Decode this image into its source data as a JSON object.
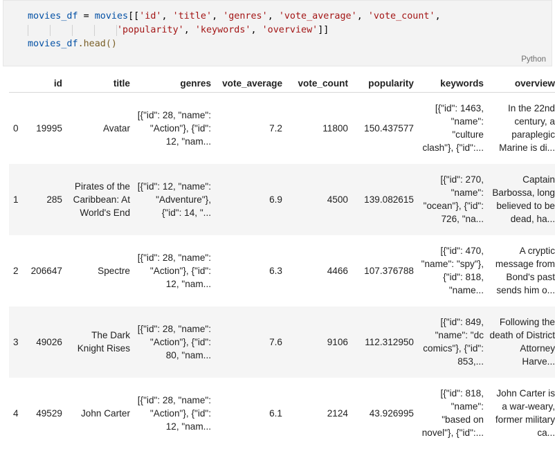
{
  "cell": {
    "code_line1": {
      "var": "movies_df",
      "eq": " = ",
      "src": "movies",
      "open": "[[",
      "cols": [
        "'id'",
        "'title'",
        "'genres'",
        "'vote_average'",
        "'vote_count'"
      ]
    },
    "code_line2": {
      "cols": [
        "'popularity'",
        "'keywords'",
        "'overview'"
      ],
      "close": "]]"
    },
    "code_line3": {
      "var": "movies_df",
      "method": ".head()"
    },
    "language": "Python"
  },
  "table": {
    "columns": [
      "",
      "id",
      "title",
      "genres",
      "vote_average",
      "vote_count",
      "popularity",
      "keywords",
      "overview"
    ],
    "rows": [
      {
        "index": "0",
        "id": "19995",
        "title": "Avatar",
        "genres": "[{\"id\": 28, \"name\": \"Action\"}, {\"id\": 12, \"nam...",
        "vote_average": "7.2",
        "vote_count": "11800",
        "popularity": "150.437577",
        "keywords": "[{\"id\": 1463, \"name\": \"culture clash\"}, {\"id\":...",
        "overview": "In the 22nd century, a paraplegic Marine is di..."
      },
      {
        "index": "1",
        "id": "285",
        "title": "Pirates of the Caribbean: At World's End",
        "genres": "[{\"id\": 12, \"name\": \"Adventure\"}, {\"id\": 14, \"...",
        "vote_average": "6.9",
        "vote_count": "4500",
        "popularity": "139.082615",
        "keywords": "[{\"id\": 270, \"name\": \"ocean\"}, {\"id\": 726, \"na...",
        "overview": "Captain Barbossa, long believed to be dead, ha..."
      },
      {
        "index": "2",
        "id": "206647",
        "title": "Spectre",
        "genres": "[{\"id\": 28, \"name\": \"Action\"}, {\"id\": 12, \"nam...",
        "vote_average": "6.3",
        "vote_count": "4466",
        "popularity": "107.376788",
        "keywords": "[{\"id\": 470, \"name\": \"spy\"}, {\"id\": 818, \"name...",
        "overview": "A cryptic message from Bond's past sends him o..."
      },
      {
        "index": "3",
        "id": "49026",
        "title": "The Dark Knight Rises",
        "genres": "[{\"id\": 28, \"name\": \"Action\"}, {\"id\": 80, \"nam...",
        "vote_average": "7.6",
        "vote_count": "9106",
        "popularity": "112.312950",
        "keywords": "[{\"id\": 849, \"name\": \"dc comics\"}, {\"id\": 853,...",
        "overview": "Following the death of District Attorney Harve..."
      },
      {
        "index": "4",
        "id": "49529",
        "title": "John Carter",
        "genres": "[{\"id\": 28, \"name\": \"Action\"}, {\"id\": 12, \"nam...",
        "vote_average": "6.1",
        "vote_count": "2124",
        "popularity": "43.926995",
        "keywords": "[{\"id\": 818, \"name\": \"based on novel\"}, {\"id\":...",
        "overview": "John Carter is a war-weary, former military ca..."
      }
    ]
  }
}
